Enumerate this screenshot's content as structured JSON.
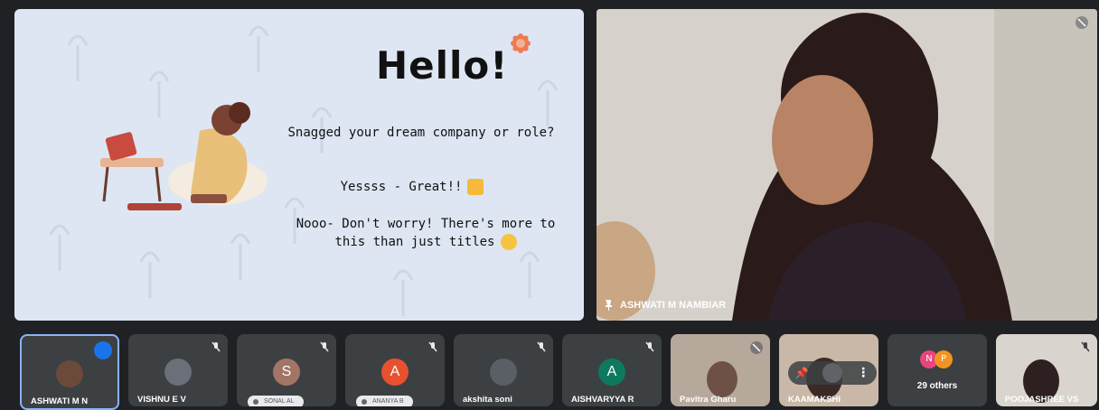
{
  "slide": {
    "title": "Hello!",
    "line1": "Snagged your dream company or role?",
    "line2": "Yessss - Great!!",
    "line3": "Nooo- Don't worry! There's more to this than just titles"
  },
  "speaker": {
    "name": "ASHWATI M NAMBIAR"
  },
  "participants": [
    {
      "name": "ASHWATI M N",
      "avatar": "",
      "color": "#6b4a3a"
    },
    {
      "name": "VISHNU E V",
      "avatar": "",
      "color": "#6a6f78"
    },
    {
      "name": "SONAL AL",
      "avatar": "S",
      "color": "#a27566"
    },
    {
      "name": "ANANYA B",
      "avatar": "A",
      "color": "#e8512f"
    },
    {
      "name": "akshita soni",
      "avatar": "",
      "color": "#5a5f66"
    },
    {
      "name": "AISHVARYYA R",
      "avatar": "A",
      "color": "#0d7a5f"
    },
    {
      "name": "Pavitra Gharu",
      "avatar": "",
      "color": "#b7a89c"
    },
    {
      "name": "KAAMAKSHI",
      "avatar": "",
      "color": "#c9b8a7"
    },
    {
      "name": "29 others",
      "avatar": "",
      "color": "#3c4043"
    },
    {
      "name": "POOJASHREE VS",
      "avatar": "",
      "color": "#d9d4ce"
    }
  ],
  "others_avatars": [
    "N",
    "P"
  ],
  "colors": {
    "background": "#202124",
    "slide_bg": "#dde6f2",
    "flower": "#f07a52",
    "active_border": "#8ab4f8"
  }
}
